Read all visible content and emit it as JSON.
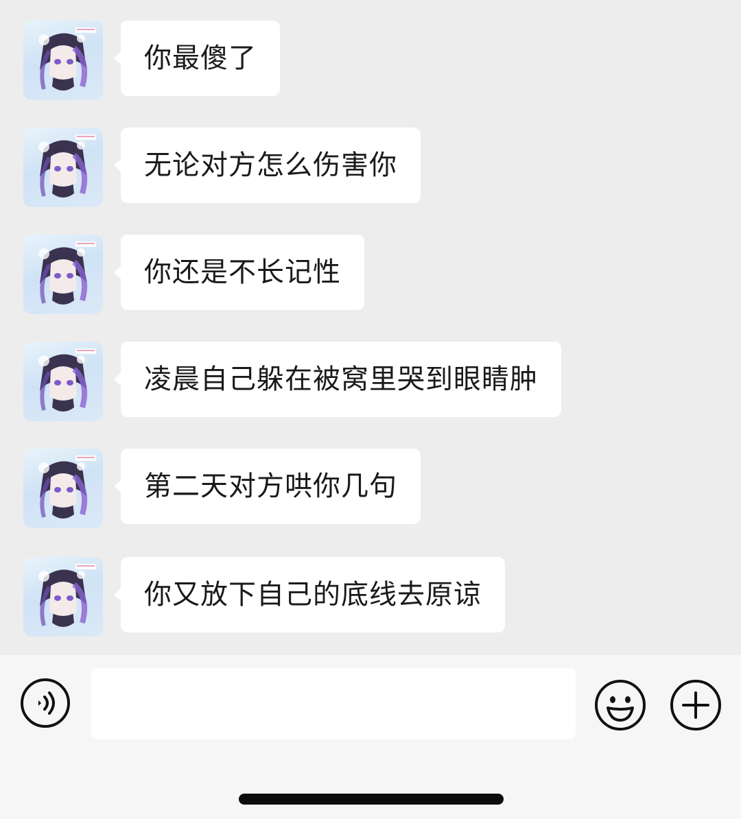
{
  "conversation": {
    "messages": [
      {
        "text": "你最傻了"
      },
      {
        "text": "无论对方怎么伤害你"
      },
      {
        "text": "你还是不长记性"
      },
      {
        "text": "凌晨自己躲在被窝里哭到眼睛肿"
      },
      {
        "text": "第二天对方哄你几句"
      },
      {
        "text": "你又放下自己的底线去原谅"
      }
    ]
  },
  "composer": {
    "value": "",
    "voice_icon": "voice-icon",
    "emoji_icon": "emoji-icon",
    "plus_icon": "plus-icon"
  },
  "colors": {
    "background": "#ededed",
    "bubble": "#ffffff",
    "text": "#1a1a1a",
    "toolbar": "#f6f6f6"
  }
}
